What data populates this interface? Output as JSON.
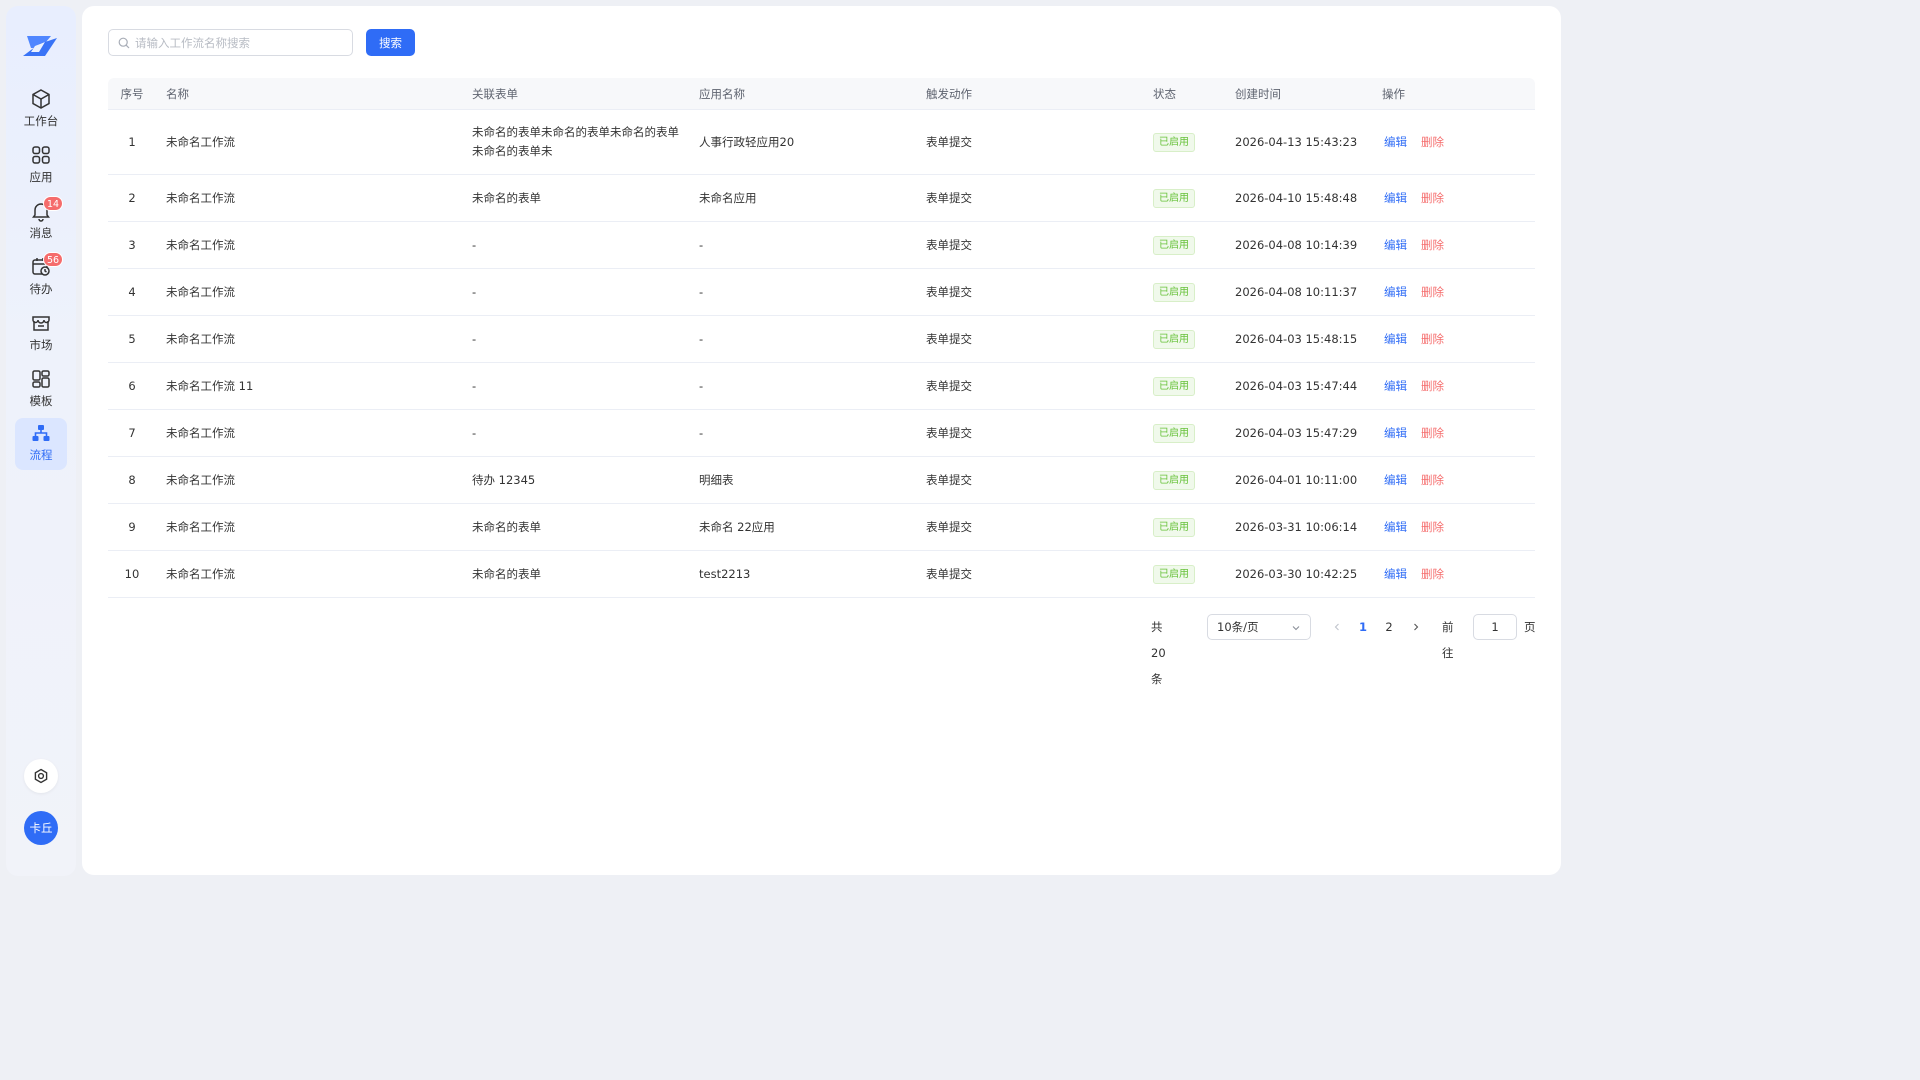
{
  "sidebar": {
    "items": [
      {
        "label": "工作台",
        "icon": "cube-icon"
      },
      {
        "label": "应用",
        "icon": "apps-grid-icon"
      },
      {
        "label": "消息",
        "icon": "bell-icon",
        "badge": "14"
      },
      {
        "label": "待办",
        "icon": "calendar-clock-icon",
        "badge": "56"
      },
      {
        "label": "市场",
        "icon": "store-icon"
      },
      {
        "label": "模板",
        "icon": "template-icon"
      },
      {
        "label": "流程",
        "icon": "flow-icon",
        "active": true
      }
    ],
    "avatar": "卡丘",
    "accent": "#2f6cf6"
  },
  "search": {
    "placeholder": "请输入工作流名称搜索",
    "value": "",
    "button": "搜索"
  },
  "table": {
    "headers": [
      "序号",
      "名称",
      "关联表单",
      "应用名称",
      "触发动作",
      "状态",
      "创建时间",
      "操作"
    ],
    "rows": [
      {
        "idx": "1",
        "name": "未命名工作流",
        "form": "未命名的表单未命名的表单未命名的表单未命名的表单未",
        "app": "人事行政轻应用20",
        "trigger": "表单提交",
        "status": "已启用",
        "created": "2026-04-13 15:43:23"
      },
      {
        "idx": "2",
        "name": "未命名工作流",
        "form": "未命名的表单",
        "app": "未命名应用",
        "trigger": "表单提交",
        "status": "已启用",
        "created": "2026-04-10 15:48:48"
      },
      {
        "idx": "3",
        "name": "未命名工作流",
        "form": "-",
        "app": "-",
        "trigger": "表单提交",
        "status": "已启用",
        "created": "2026-04-08 10:14:39"
      },
      {
        "idx": "4",
        "name": "未命名工作流",
        "form": "-",
        "app": "-",
        "trigger": "表单提交",
        "status": "已启用",
        "created": "2026-04-08 10:11:37"
      },
      {
        "idx": "5",
        "name": "未命名工作流",
        "form": "-",
        "app": "-",
        "trigger": "表单提交",
        "status": "已启用",
        "created": "2026-04-03 15:48:15"
      },
      {
        "idx": "6",
        "name": "未命名工作流 11",
        "form": "-",
        "app": "-",
        "trigger": "表单提交",
        "status": "已启用",
        "created": "2026-04-03 15:47:44"
      },
      {
        "idx": "7",
        "name": "未命名工作流",
        "form": "-",
        "app": "-",
        "trigger": "表单提交",
        "status": "已启用",
        "created": "2026-04-03 15:47:29"
      },
      {
        "idx": "8",
        "name": "未命名工作流",
        "form": "待办 12345",
        "app": "明细表",
        "trigger": "表单提交",
        "status": "已启用",
        "created": "2026-04-01 10:11:00"
      },
      {
        "idx": "9",
        "name": "未命名工作流",
        "form": "未命名的表单",
        "app": "未命名 22应用",
        "trigger": "表单提交",
        "status": "已启用",
        "created": "2026-03-31 10:06:14"
      },
      {
        "idx": "10",
        "name": "未命名工作流",
        "form": "未命名的表单",
        "app": "test2213",
        "trigger": "表单提交",
        "status": "已启用",
        "created": "2026-03-30 10:42:25"
      }
    ],
    "actions": {
      "edit": "编辑",
      "delete": "删除"
    }
  },
  "pagination": {
    "total": "共 20 条",
    "page_size": "10条/页",
    "pages": [
      "1",
      "2"
    ],
    "current": "1",
    "goto_label": "前往",
    "goto_value": "1",
    "page_suffix": "页"
  }
}
